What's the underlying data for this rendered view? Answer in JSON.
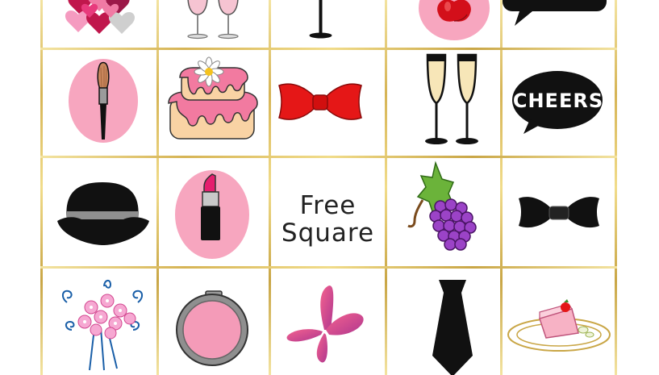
{
  "board": {
    "rows": [
      [
        {
          "name": "hearts",
          "icon": "hearts-icon"
        },
        {
          "name": "wine-glasses",
          "icon": "wine-glasses-icon"
        },
        {
          "name": "martini-glass",
          "icon": "martini-glass-icon"
        },
        {
          "name": "apple",
          "icon": "apple-icon"
        },
        {
          "name": "speech-bubble",
          "icon": "speech-bubble-icon"
        }
      ],
      [
        {
          "name": "makeup-brush",
          "icon": "makeup-brush-icon"
        },
        {
          "name": "cake",
          "icon": "cake-icon"
        },
        {
          "name": "red-bow-tie",
          "icon": "red-bow-tie-icon"
        },
        {
          "name": "champagne-flutes",
          "icon": "champagne-flutes-icon"
        },
        {
          "name": "cheers-bubble",
          "icon": "cheers-bubble-icon",
          "text": "CHEERS"
        }
      ],
      [
        {
          "name": "bowler-hat",
          "icon": "bowler-hat-icon"
        },
        {
          "name": "lipstick",
          "icon": "lipstick-icon"
        },
        {
          "name": "free-square",
          "text_line1": "Free",
          "text_line2": "Square"
        },
        {
          "name": "grapes",
          "icon": "grapes-icon"
        },
        {
          "name": "black-bow-tie",
          "icon": "black-bow-tie-icon"
        }
      ],
      [
        {
          "name": "bouquet",
          "icon": "bouquet-icon"
        },
        {
          "name": "compact-mirror",
          "icon": "compact-mirror-icon"
        },
        {
          "name": "butterfly",
          "icon": "butterfly-icon"
        },
        {
          "name": "necktie",
          "icon": "necktie-icon"
        },
        {
          "name": "cake-slice",
          "icon": "cake-slice-icon"
        }
      ]
    ]
  },
  "colors": {
    "grid_gold": "#d6b455",
    "pink_circle": "#f7a6bf",
    "red": "#e51717",
    "black": "#111111"
  }
}
